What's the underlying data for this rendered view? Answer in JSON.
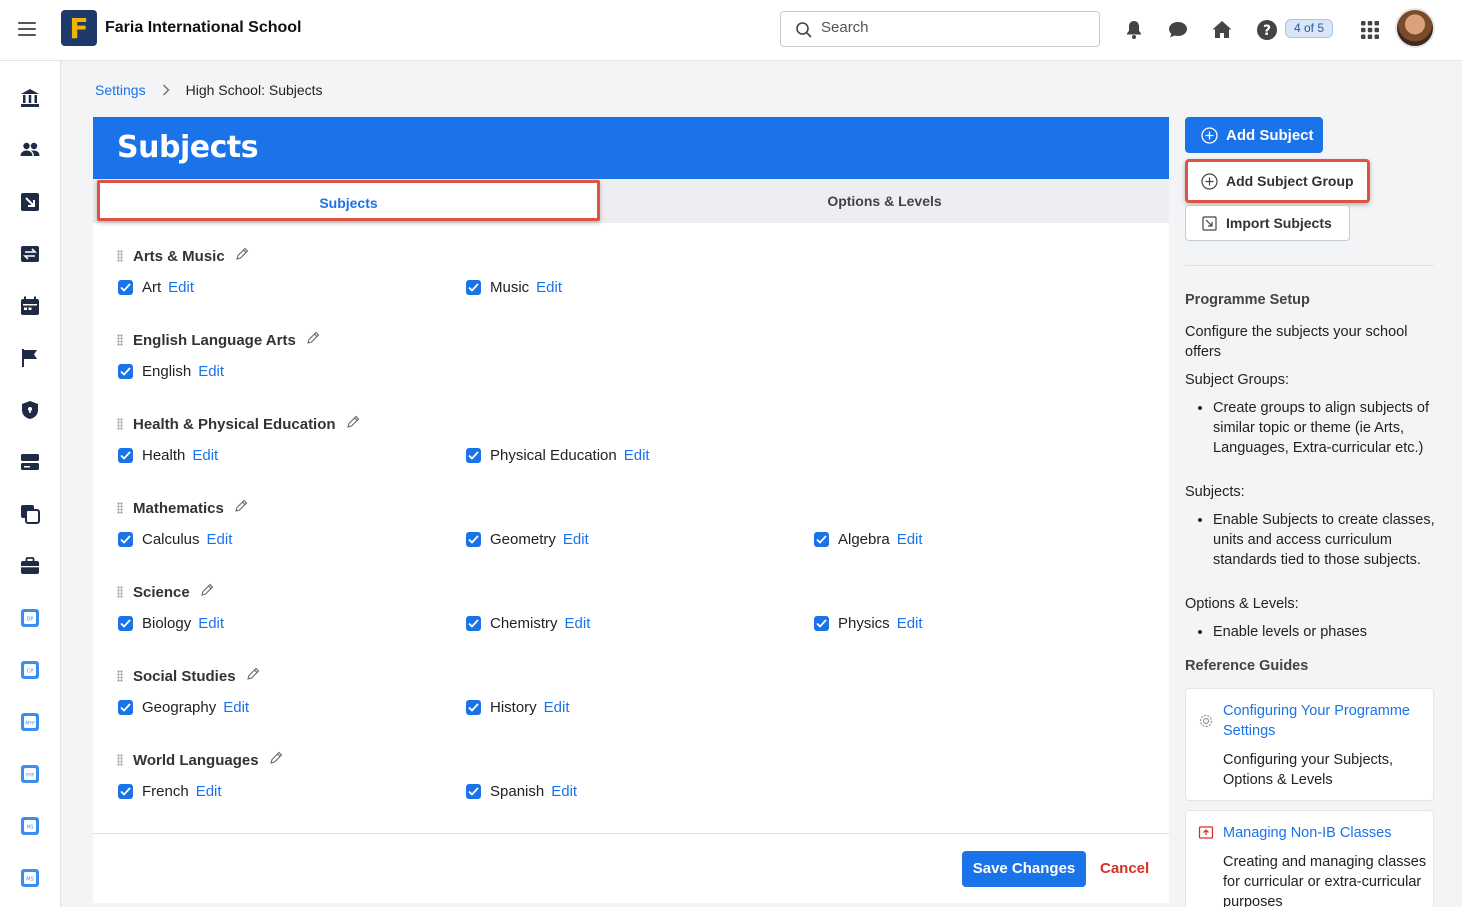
{
  "app": {
    "school_name": "Faria International School",
    "logo_letter": "F"
  },
  "search": {
    "placeholder": "Search"
  },
  "header": {
    "page_counter": "4 of 5"
  },
  "breadcrumb": {
    "parent": "Settings",
    "current": "High School: Subjects"
  },
  "panel": {
    "title": "Subjects",
    "tabs": [
      {
        "label": "Subjects"
      },
      {
        "label": "Options & Levels"
      }
    ],
    "edit_label": "Edit",
    "groups": [
      {
        "name": "Arts & Music",
        "subjects": [
          {
            "name": "Art"
          },
          {
            "name": "Music"
          }
        ]
      },
      {
        "name": "English Language Arts",
        "subjects": [
          {
            "name": "English"
          }
        ]
      },
      {
        "name": "Health & Physical Education",
        "subjects": [
          {
            "name": "Health"
          },
          {
            "name": "Physical Education"
          }
        ]
      },
      {
        "name": "Mathematics",
        "subjects": [
          {
            "name": "Calculus"
          },
          {
            "name": "Geometry"
          },
          {
            "name": "Algebra"
          }
        ]
      },
      {
        "name": "Science",
        "subjects": [
          {
            "name": "Biology"
          },
          {
            "name": "Chemistry"
          },
          {
            "name": "Physics"
          }
        ]
      },
      {
        "name": "Social Studies",
        "subjects": [
          {
            "name": "Geography"
          },
          {
            "name": "History"
          }
        ]
      },
      {
        "name": "World Languages",
        "subjects": [
          {
            "name": "French"
          },
          {
            "name": "Spanish"
          }
        ]
      }
    ],
    "save_label": "Save Changes",
    "cancel_label": "Cancel"
  },
  "actions": {
    "add_subject": "Add Subject",
    "add_subject_group": "Add Subject Group",
    "import_subjects": "Import Subjects"
  },
  "help": {
    "heading": "Programme Setup",
    "intro": "Configure the subjects your school offers",
    "subject_groups_label": "Subject Groups:",
    "subject_groups_bullet": "Create groups to align subjects of similar topic or theme (ie Arts, Languages, Extra-curricular etc.)",
    "subjects_label": "Subjects:",
    "subjects_bullet": "Enable Subjects to create classes, units and access curriculum standards tied to those subjects.",
    "options_label": "Options & Levels:",
    "options_bullet": "Enable levels or phases",
    "reference_heading": "Reference Guides",
    "guides": [
      {
        "title": "Configuring Your Programme Settings",
        "description": "Configuring your Subjects, Options & Levels"
      },
      {
        "title": "Managing Non-IB Classes",
        "description": "Creating and managing classes for curricular or extra-curricular purposes"
      }
    ]
  },
  "colors": {
    "primary": "#1a73e8",
    "highlight": "#e05343",
    "danger": "#d93025"
  }
}
